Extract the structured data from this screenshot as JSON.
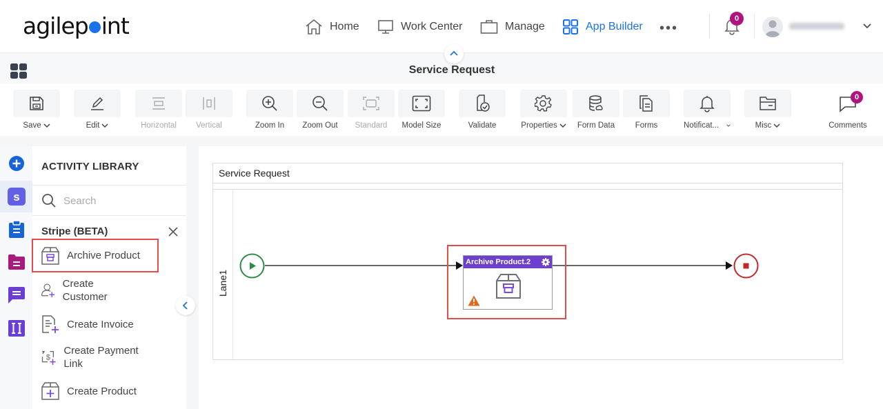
{
  "app": {
    "logo_text_left": "agilep",
    "logo_text_right": "int",
    "brand_color": "#1a73e8"
  },
  "topnav": {
    "items": [
      {
        "label": "Home",
        "icon": "home-icon"
      },
      {
        "label": "Work Center",
        "icon": "monitor-icon"
      },
      {
        "label": "Manage",
        "icon": "briefcase-icon"
      },
      {
        "label": "App Builder",
        "icon": "grid-icon",
        "active": true
      }
    ],
    "more_label": "•••",
    "notifications_count": "0",
    "user_name": "[blurred]"
  },
  "titlebar": {
    "title": "Service Request"
  },
  "toolbar": {
    "buttons": [
      {
        "label": "Save",
        "dropdown": true
      },
      {
        "label": "Edit",
        "dropdown": true
      },
      {
        "label": "Horizontal",
        "disabled": true
      },
      {
        "label": "Vertical",
        "disabled": true
      },
      {
        "label": "Zoom In"
      },
      {
        "label": "Zoom Out"
      },
      {
        "label": "Standard",
        "disabled": true
      },
      {
        "label": "Model Size"
      },
      {
        "label": "Validate"
      },
      {
        "label": "Properties",
        "dropdown": true
      },
      {
        "label": "Form Data"
      },
      {
        "label": "Forms"
      },
      {
        "label": "Notificat...",
        "dropdown": true
      },
      {
        "label": "Misc",
        "dropdown": true
      },
      {
        "label": "Comments",
        "badge": "0"
      }
    ]
  },
  "rail": {
    "items": [
      {
        "icon": "add-circle-icon",
        "color": "#1565d8"
      },
      {
        "icon": "stripe-icon",
        "color": "#6460e6",
        "selected": true
      },
      {
        "icon": "clipboard-icon",
        "color": "#1565d8"
      },
      {
        "icon": "folder-icon",
        "color": "#a91a7d"
      },
      {
        "icon": "chat-icon",
        "color": "#6a3fd0"
      },
      {
        "icon": "text-field-icon",
        "color": "#6a3fd0"
      }
    ]
  },
  "library": {
    "title": "ACTIVITY LIBRARY",
    "search_placeholder": "Search",
    "category": "Stripe (BETA)",
    "items": [
      {
        "label": "Archive Product",
        "highlighted": true
      },
      {
        "label": "Create Customer"
      },
      {
        "label": "Create Invoice"
      },
      {
        "label": "Create Payment Link"
      },
      {
        "label": "Create Product"
      }
    ]
  },
  "canvas": {
    "pool_title": "Service Request",
    "lane_label": "Lane1",
    "task_title": "Archive Product.2",
    "task_header_color": "#6c3fd1",
    "start_color": "#2e8b45",
    "end_color": "#c62828",
    "warning_color": "#e0681b"
  }
}
